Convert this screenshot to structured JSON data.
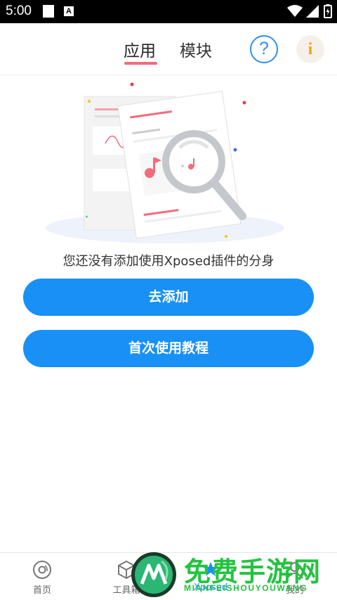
{
  "status_bar": {
    "time": "5:00",
    "notif_icon": "A"
  },
  "header": {
    "tabs": [
      {
        "label": "应用",
        "active": true
      },
      {
        "label": "模块",
        "active": false
      }
    ],
    "help_icon": "?",
    "info_icon": "i"
  },
  "empty_state": {
    "message": "您还没有添加使用Xposed插件的分身"
  },
  "actions": {
    "add_label": "去添加",
    "tutorial_label": "首次使用教程"
  },
  "bottom_nav": [
    {
      "label": "首页",
      "icon": "home-disc-icon"
    },
    {
      "label": "工具箱",
      "icon": "cube-icon"
    },
    {
      "label": "Xposed",
      "icon": "xposed-icon"
    },
    {
      "label": "我的",
      "icon": "profile-icon"
    }
  ],
  "watermark": {
    "title": "免费手游网",
    "subtitle": "MIANFEISHOUYOUWANG"
  },
  "colors": {
    "accent": "#1890f6",
    "tab_indicator": "#f26b7a",
    "info": "#f2a21b",
    "watermark": "#25c240"
  }
}
